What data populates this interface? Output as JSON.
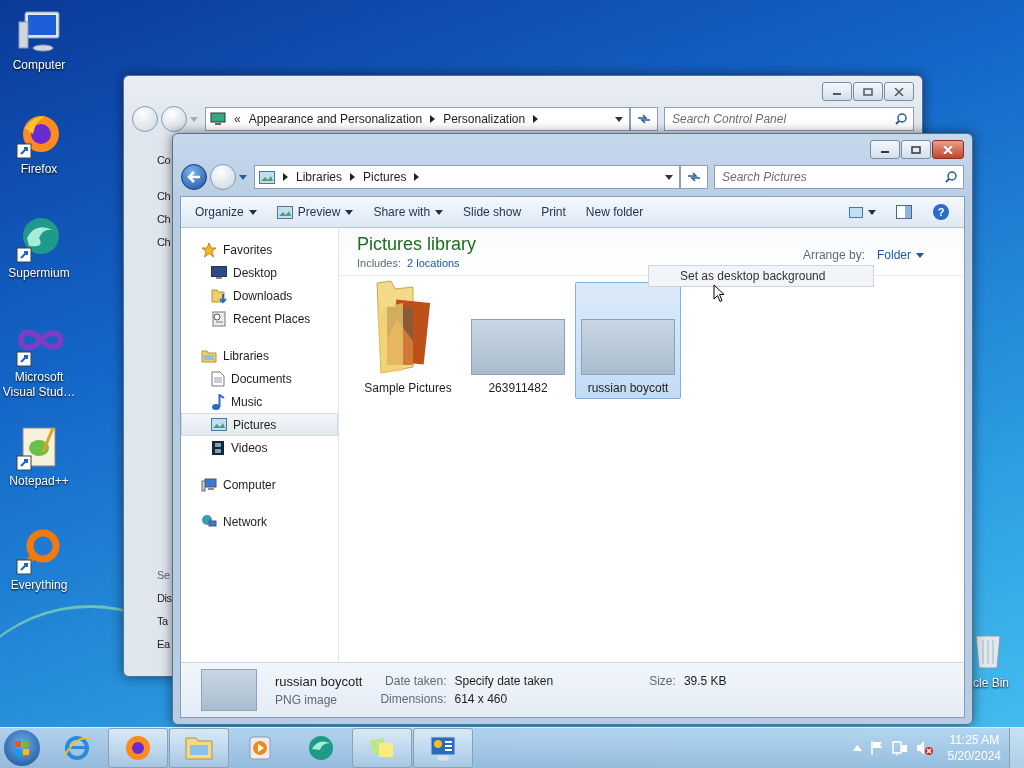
{
  "desktop_icons": [
    {
      "label": "Computer",
      "kind": "monitor"
    },
    {
      "label": "Firefox",
      "kind": "globe"
    },
    {
      "label": "Supermium",
      "kind": "swirl"
    },
    {
      "label": "Microsoft Visual Stud…",
      "kind": "infinity"
    },
    {
      "label": "Notepad++",
      "kind": "notepad"
    },
    {
      "label": "Everything",
      "kind": "ring"
    }
  ],
  "recycle_bin_label": "cle Bin",
  "background_window": {
    "address_overflow": "«",
    "address": [
      "Appearance and Personalization",
      "Personalization"
    ],
    "search_placeholder": "Search Control Panel",
    "fragments_top": [
      "Co",
      "Ch",
      "Ch",
      "Ch"
    ],
    "fragments_bottom": [
      "Se",
      "Dis",
      "Ta",
      "Ea"
    ]
  },
  "explorer": {
    "address": [
      "Libraries",
      "Pictures"
    ],
    "search_placeholder": "Search Pictures",
    "toolbar": [
      {
        "label": "Organize",
        "dropdown": true,
        "kind": "plain"
      },
      {
        "label": "Preview",
        "dropdown": true,
        "kind": "preview"
      },
      {
        "label": "Share with",
        "dropdown": true,
        "kind": "plain"
      },
      {
        "label": "Slide show",
        "dropdown": false,
        "kind": "plain"
      },
      {
        "label": "Print",
        "dropdown": false,
        "kind": "plain"
      },
      {
        "label": "New folder",
        "dropdown": false,
        "kind": "plain"
      }
    ],
    "help_label": "?",
    "nav": [
      {
        "label": "Favorites",
        "kind": "star",
        "selected": false,
        "children": [
          {
            "label": "Desktop",
            "kind": "desktop",
            "selected": false
          },
          {
            "label": "Downloads",
            "kind": "download",
            "selected": false
          },
          {
            "label": "Recent Places",
            "kind": "recent",
            "selected": false
          }
        ]
      },
      {
        "label": "Libraries",
        "kind": "library",
        "selected": false,
        "children": [
          {
            "label": "Documents",
            "kind": "document",
            "selected": false
          },
          {
            "label": "Music",
            "kind": "music",
            "selected": false
          },
          {
            "label": "Pictures",
            "kind": "picture",
            "selected": true
          },
          {
            "label": "Videos",
            "kind": "video",
            "selected": false
          }
        ]
      },
      {
        "label": "Computer",
        "kind": "computer",
        "selected": false
      },
      {
        "label": "Network",
        "kind": "network",
        "selected": false
      }
    ],
    "heading": "Pictures library",
    "includes_label": "Includes:",
    "includes_link": "2 locations",
    "arrange_label": "Arrange by:",
    "arrange_value": "Folder",
    "files": [
      {
        "name": "Sample Pictures",
        "kind": "folder",
        "selected": false
      },
      {
        "name": "263911482",
        "kind": "image",
        "selected": false
      },
      {
        "name": "russian boycott",
        "kind": "image",
        "selected": true
      }
    ],
    "tooltip": "Set as desktop background",
    "details": {
      "name": "russian boycott",
      "type": "PNG image",
      "fields": [
        {
          "label": "Date taken:",
          "value": "Specify date taken"
        },
        {
          "label": "Dimensions:",
          "value": "614 x 460"
        },
        {
          "label": "Size:",
          "value": "39.5 KB"
        }
      ]
    }
  },
  "taskbar": {
    "items": [
      {
        "kind": "ie",
        "running": false
      },
      {
        "kind": "globe",
        "running": true
      },
      {
        "kind": "explorer",
        "running": true
      },
      {
        "kind": "media",
        "running": false
      },
      {
        "kind": "swirl",
        "running": false
      },
      {
        "kind": "notes",
        "running": true
      },
      {
        "kind": "panel",
        "running": true
      }
    ],
    "time": "11:25 AM",
    "date": "5/20/2024"
  }
}
